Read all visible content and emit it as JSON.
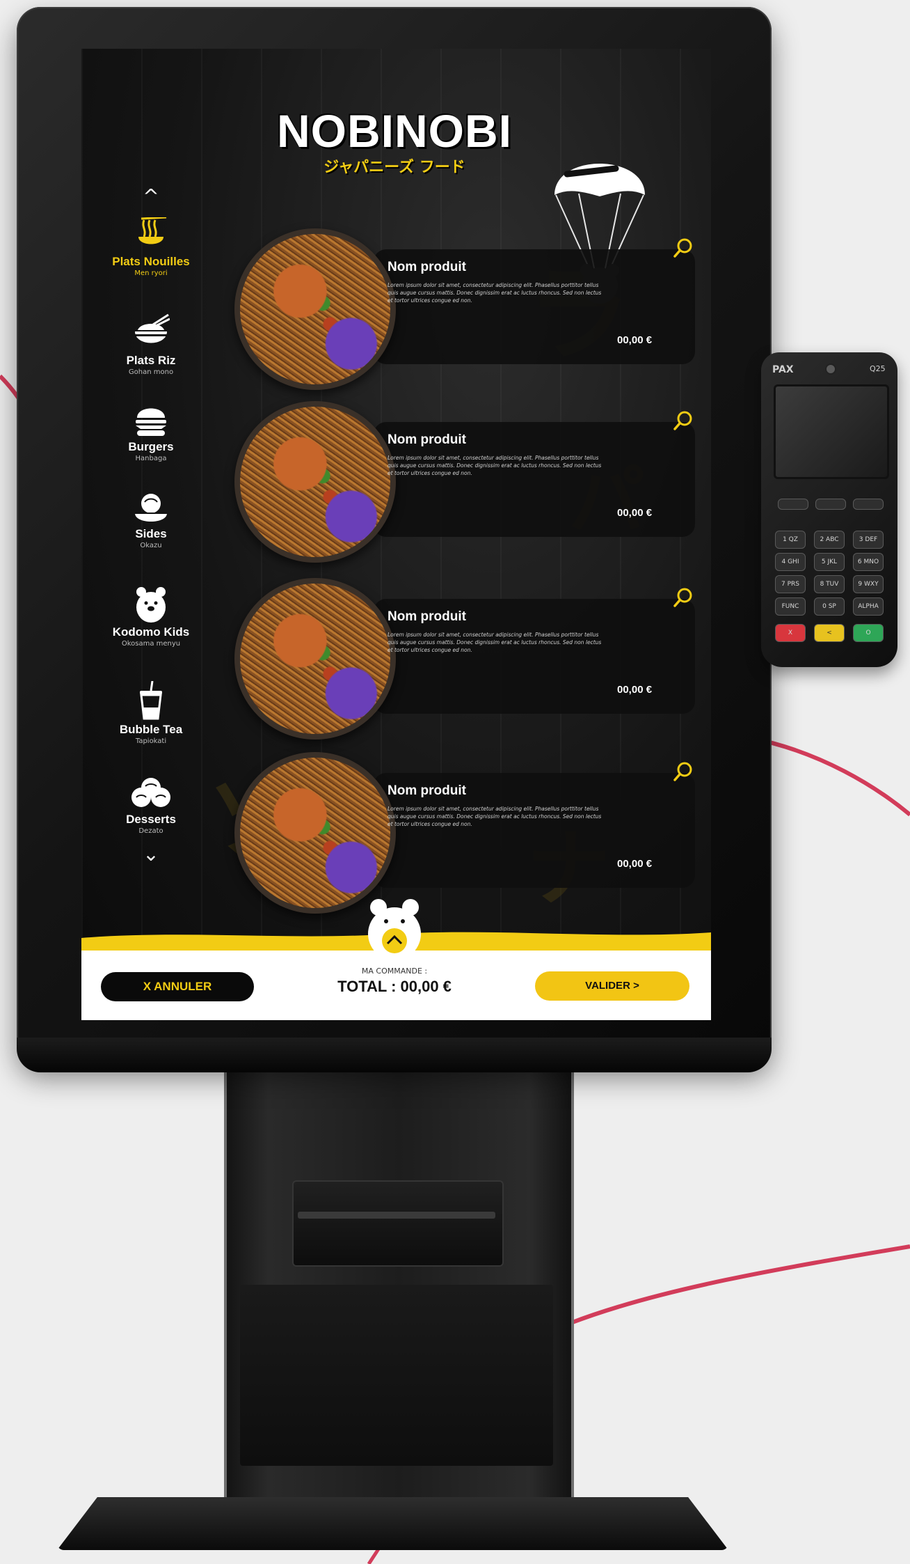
{
  "brand": {
    "name": "NOBINOBI",
    "subtitle": "ジャパニーズ フード"
  },
  "terminal": {
    "brand": "PAX",
    "model": "Q25",
    "keys": [
      "1 QZ",
      "2 ABC",
      "3 DEF",
      "4 GHI",
      "5 JKL",
      "6 MNO",
      "7 PRS",
      "8 TUV",
      "9 WXY",
      "FUNC",
      "0 SP",
      "ALPHA",
      "X",
      "<",
      "O"
    ]
  },
  "navigation": {
    "up_arrow": "^",
    "down_arrow": "⌄",
    "categories": [
      {
        "label": "Plats Nouilles",
        "sub": "Men ryori",
        "icon": "noodle-bowl-icon",
        "active": true
      },
      {
        "label": "Plats Riz",
        "sub": "Gohan mono",
        "icon": "rice-bowl-icon",
        "active": false
      },
      {
        "label": "Burgers",
        "sub": "Hanbaga",
        "icon": "burger-icon",
        "active": false
      },
      {
        "label": "Sides",
        "sub": "Okazu",
        "icon": "dumplings-icon",
        "active": false
      },
      {
        "label": "Kodomo Kids",
        "sub": "Okosama menyu",
        "icon": "bear-icon",
        "active": false
      },
      {
        "label": "Bubble Tea",
        "sub": "Tapiokati",
        "icon": "bubble-tea-icon",
        "active": false
      },
      {
        "label": "Desserts",
        "sub": "Dezato",
        "icon": "mochi-icon",
        "active": false
      }
    ]
  },
  "products": [
    {
      "name": "Nom produit",
      "description": "Lorem ipsum dolor sit amet, consectetur adipiscing elit. Phasellus porttitor tellus quis augue cursus mattis. Donec dignissim erat ac luctus rhoncus. Sed non lectus et tortor ultrices congue ed non.",
      "price": "00,00 €"
    },
    {
      "name": "Nom produit",
      "description": "Lorem ipsum dolor sit amet, consectetur adipiscing elit. Phasellus porttitor tellus quis augue cursus mattis. Donec dignissim erat ac luctus rhoncus. Sed non lectus et tortor ultrices congue ed non.",
      "price": "00,00 €"
    },
    {
      "name": "Nom produit",
      "description": "Lorem ipsum dolor sit amet, consectetur adipiscing elit. Phasellus porttitor tellus quis augue cursus mattis. Donec dignissim erat ac luctus rhoncus. Sed non lectus et tortor ultrices congue ed non.",
      "price": "00,00 €"
    },
    {
      "name": "Nom produit",
      "description": "Lorem ipsum dolor sit amet, consectetur adipiscing elit. Phasellus porttitor tellus quis augue cursus mattis. Donec dignissim erat ac luctus rhoncus. Sed non lectus et tortor ultrices congue ed non.",
      "price": "00,00 €"
    }
  ],
  "footer": {
    "cancel_label": "X ANNULER",
    "order_caption": "MA COMMANDE :",
    "total_text": "TOTAL : 00,00 €",
    "validate_label": "VALIDER >"
  },
  "colors": {
    "accent_yellow": "#f2cc14",
    "background_dark": "#121212",
    "decor_curve": "#d23c5a"
  }
}
